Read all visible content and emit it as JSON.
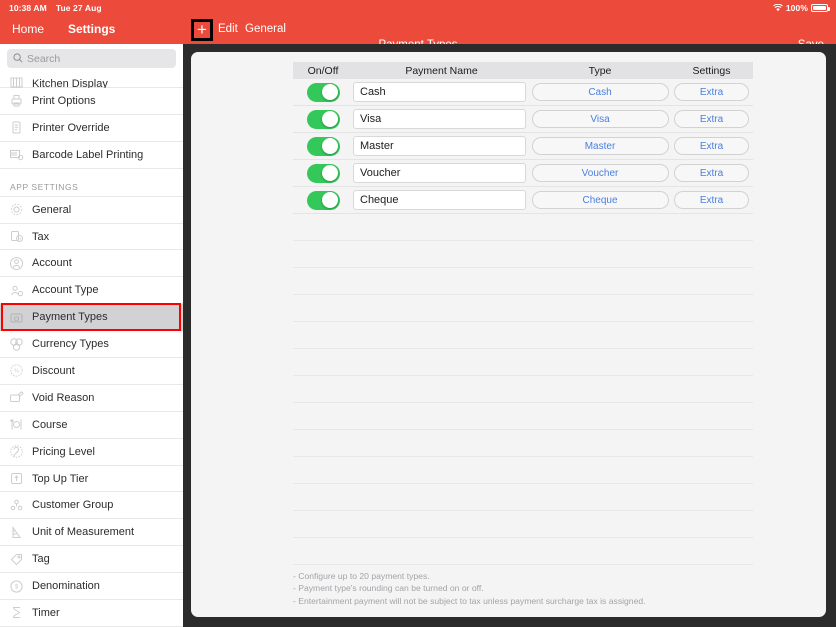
{
  "statusbar": {
    "time": "10:38 AM",
    "date": "Tue 27 Aug",
    "battery_pct": "100%",
    "wifi_icon": "wifi-icon",
    "battery_icon": "battery-icon"
  },
  "navbar": {
    "home": "Home",
    "settings": "Settings",
    "add_glyph": "+",
    "edit": "Edit",
    "general": "General",
    "title": "Payment Types",
    "save": "Save",
    "bar_color": "#ec4b3b"
  },
  "sidebar": {
    "search_placeholder": "Search",
    "search_value": "",
    "search_icon": "search-icon",
    "items_top": [
      {
        "label": "Kitchen Display",
        "icon": "kitchen-display-icon",
        "clipped": true
      },
      {
        "label": "Print Options",
        "icon": "printer-icon"
      },
      {
        "label": "Printer Override",
        "icon": "document-icon"
      },
      {
        "label": "Barcode Label Printing",
        "icon": "barcode-icon"
      }
    ],
    "section_label": "APP SETTINGS",
    "items_app": [
      {
        "label": "General",
        "icon": "gear-icon"
      },
      {
        "label": "Tax",
        "icon": "tax-icon"
      },
      {
        "label": "Account",
        "icon": "account-icon"
      },
      {
        "label": "Account Type",
        "icon": "account-type-icon"
      },
      {
        "label": "Payment Types",
        "icon": "payment-types-icon",
        "selected": true
      },
      {
        "label": "Currency Types",
        "icon": "currency-icon"
      },
      {
        "label": "Discount",
        "icon": "discount-icon"
      },
      {
        "label": "Void Reason",
        "icon": "void-reason-icon"
      },
      {
        "label": "Course",
        "icon": "course-icon"
      },
      {
        "label": "Pricing Level",
        "icon": "pricing-level-icon"
      },
      {
        "label": "Top Up Tier",
        "icon": "top-up-tier-icon"
      },
      {
        "label": "Customer Group",
        "icon": "customer-group-icon"
      },
      {
        "label": "Unit of Measurement",
        "icon": "measurement-icon"
      },
      {
        "label": "Tag",
        "icon": "tag-icon"
      },
      {
        "label": "Denomination",
        "icon": "denomination-icon"
      },
      {
        "label": "Timer",
        "icon": "timer-icon"
      }
    ]
  },
  "table": {
    "headers": {
      "onoff": "On/Off",
      "name": "Payment Name",
      "type": "Type",
      "settings": "Settings"
    },
    "rows": [
      {
        "enabled": true,
        "name": "Cash",
        "type": "Cash",
        "settings": "Extra"
      },
      {
        "enabled": true,
        "name": "Visa",
        "type": "Visa",
        "settings": "Extra"
      },
      {
        "enabled": true,
        "name": "Master",
        "type": "Master",
        "settings": "Extra"
      },
      {
        "enabled": true,
        "name": "Voucher",
        "type": "Voucher",
        "settings": "Extra"
      },
      {
        "enabled": true,
        "name": "Cheque",
        "type": "Cheque",
        "settings": "Extra"
      }
    ],
    "empty_row_count": 13
  },
  "notes": [
    "- Configure up to 20 payment types.",
    "- Payment type's rounding can be turned on or off.",
    "- Entertainment payment will not be subject to tax unless payment surcharge tax is assigned."
  ],
  "annotations": {
    "plus_button_highlight_color": "#000000",
    "sidebar_selected_highlight_color": "#ff0000"
  },
  "colors": {
    "accent_red": "#ec4b3b",
    "toggle_green": "#34c759",
    "link_blue": "#4a7fe0",
    "panel_bg": "#f4f4f4"
  }
}
